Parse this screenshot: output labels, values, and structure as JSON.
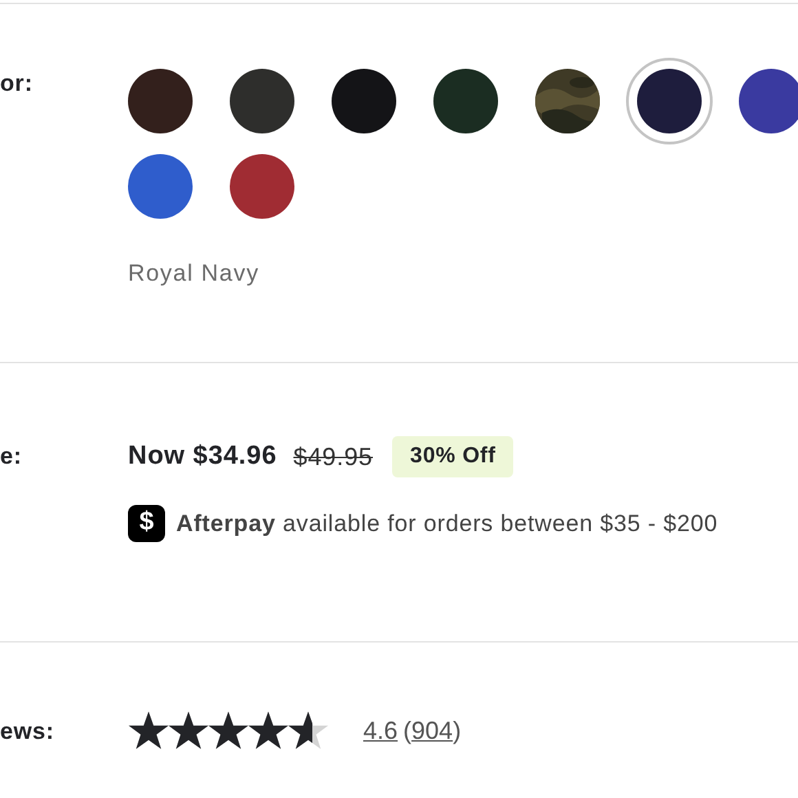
{
  "color_section": {
    "label": "or:",
    "swatches": [
      {
        "color": "#33201c",
        "selected": false
      },
      {
        "color": "#2e2e2c",
        "selected": false
      },
      {
        "color": "#141417",
        "selected": false
      },
      {
        "color": "#1b2d22",
        "selected": false
      },
      {
        "color": "#3f3a26",
        "kind": "picture",
        "selected": false
      },
      {
        "color": "#1e1d3d",
        "selected": true
      },
      {
        "color": "#3a3aa0",
        "selected": false
      },
      {
        "color": "#2f5dcc",
        "selected": false
      },
      {
        "color": "#a02c33",
        "selected": false
      }
    ],
    "selected_name": "Royal Navy"
  },
  "price_section": {
    "label": "e:",
    "now_price": "Now $34.96",
    "old_price": "$49.95",
    "discount": "30% Off",
    "afterpay_icon": "$",
    "afterpay_text": "**Afterpay** available for orders between $35 - $200"
  },
  "reviews_section": {
    "label": "ews:",
    "stars": 4.6,
    "rating": "4.6",
    "count_open": "(",
    "count": "904",
    "count_close": ")"
  }
}
